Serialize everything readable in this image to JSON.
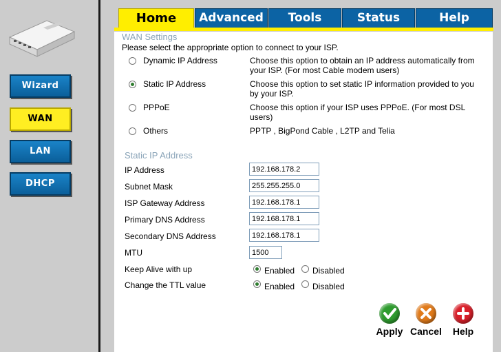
{
  "sidebar": {
    "items": [
      {
        "label": "Wizard",
        "active": false
      },
      {
        "label": "WAN",
        "active": true
      },
      {
        "label": "LAN",
        "active": false
      },
      {
        "label": "DHCP",
        "active": false
      }
    ]
  },
  "tabs": [
    {
      "label": "Home",
      "active": true
    },
    {
      "label": "Advanced",
      "active": false
    },
    {
      "label": "Tools",
      "active": false
    },
    {
      "label": "Status",
      "active": false
    },
    {
      "label": "Help",
      "active": false
    }
  ],
  "wan": {
    "title": "WAN Settings",
    "intro": "Please select the appropriate option to connect to your ISP.",
    "options": [
      {
        "name": "Dynamic IP Address",
        "desc": "Choose this option to obtain an IP address automatically from your ISP. (For most Cable modem users)",
        "selected": false
      },
      {
        "name": "Static IP Address",
        "desc": "Choose this option to set static IP information provided to you by your ISP.",
        "selected": true
      },
      {
        "name": "PPPoE",
        "desc": "Choose this option if your ISP uses PPPoE. (For most DSL users)",
        "selected": false
      },
      {
        "name": "Others",
        "desc": "PPTP , BigPond Cable , L2TP and Telia",
        "selected": false
      }
    ]
  },
  "static": {
    "title": "Static IP Address",
    "fields": [
      {
        "label": "IP Address",
        "value": "192.168.178.2"
      },
      {
        "label": "Subnet Mask",
        "value": "255.255.255.0"
      },
      {
        "label": "ISP Gateway Address",
        "value": "192.168.178.1"
      },
      {
        "label": "Primary DNS Address",
        "value": "192.168.178.1"
      },
      {
        "label": "Secondary DNS Address",
        "value": "192.168.178.1"
      },
      {
        "label": "MTU",
        "value": "1500"
      }
    ],
    "keepalive": {
      "label": "Keep Alive with up",
      "enabled": "Enabled",
      "disabled": "Disabled",
      "selected": "enabled"
    },
    "ttl": {
      "label": "Change the TTL value",
      "enabled": "Enabled",
      "disabled": "Disabled",
      "selected": "enabled"
    }
  },
  "actions": {
    "apply": {
      "label": "Apply",
      "color": "#2e9b2e"
    },
    "cancel": {
      "label": "Cancel",
      "color": "#e07a1a"
    },
    "help": {
      "label": "Help",
      "color": "#d8202a"
    }
  }
}
